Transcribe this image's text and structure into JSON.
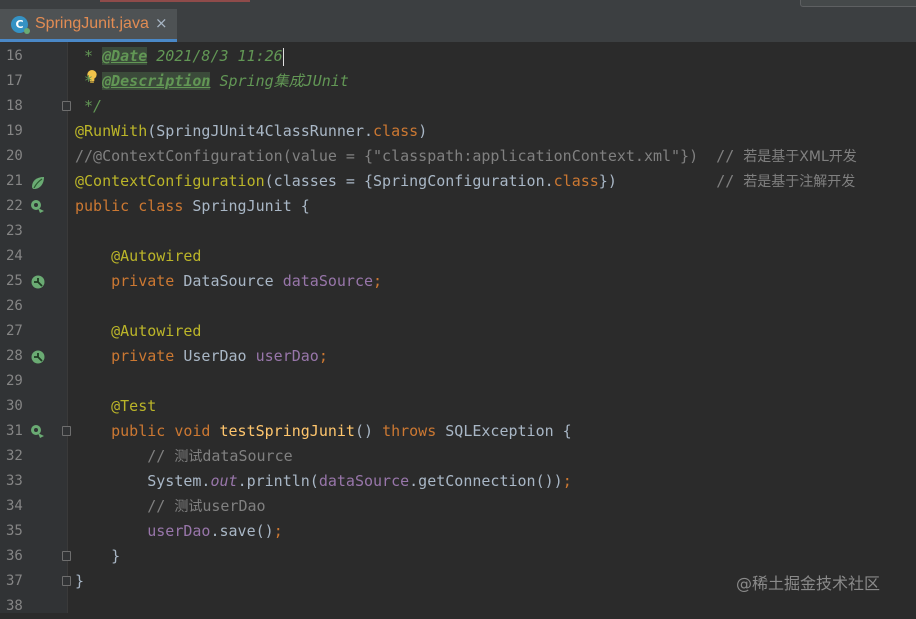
{
  "tab": {
    "label": "SpringJunit.java",
    "close": "×",
    "icon_letter": "C"
  },
  "lines": [
    {
      "n": "16"
    },
    {
      "n": "17"
    },
    {
      "n": "18"
    },
    {
      "n": "19"
    },
    {
      "n": "20"
    },
    {
      "n": "21"
    },
    {
      "n": "22"
    },
    {
      "n": "23"
    },
    {
      "n": "24"
    },
    {
      "n": "25"
    },
    {
      "n": "26"
    },
    {
      "n": "27"
    },
    {
      "n": "28"
    },
    {
      "n": "29"
    },
    {
      "n": "30"
    },
    {
      "n": "31"
    },
    {
      "n": "32"
    },
    {
      "n": "33"
    },
    {
      "n": "34"
    },
    {
      "n": "35"
    },
    {
      "n": "36"
    },
    {
      "n": "37"
    },
    {
      "n": "38"
    }
  ],
  "code": {
    "l16": {
      "star": " * ",
      "tag": "@Date",
      "text": " 2021/8/3 11:26"
    },
    "l17": {
      "star": " * ",
      "tag": "@Description",
      "text": " Spring集成JUnit"
    },
    "l18": {
      "text": " */"
    },
    "l19": {
      "ann": "@RunWith",
      "p1": "(SpringJUnit4ClassRunner.",
      "kw": "class",
      "p2": ")"
    },
    "l20": {
      "text": "//@ContextConfiguration(value = {\"classpath:applicationContext.xml\"})  // ",
      "zh": "若是基于XML开发"
    },
    "l21": {
      "ann": "@ContextConfiguration",
      "p1": "(classes = {SpringConfiguration.",
      "kw": "class",
      "p2": "})",
      "pad": "           ",
      "cm": "// ",
      "zh": "若是基于注解开发"
    },
    "l22": {
      "kw1": "public",
      "kw2": "class",
      "name": " SpringJunit {"
    },
    "l24": {
      "ann": "@Autowired"
    },
    "l25": {
      "kw": "private",
      "type": " DataSource ",
      "field": "dataSource",
      "end": ";"
    },
    "l27": {
      "ann": "@Autowired"
    },
    "l28": {
      "kw": "private",
      "type": " UserDao ",
      "field": "userDao",
      "end": ";"
    },
    "l30": {
      "ann": "@Test"
    },
    "l31": {
      "kw1": "public",
      "kw2": "void",
      "method": "testSpringJunit",
      "p1": "() ",
      "kw3": "throws",
      "p2": " SQLException {"
    },
    "l32": {
      "cm": "// ",
      "zh": "测试",
      "rest": "dataSource"
    },
    "l33": {
      "sys": "System.",
      "static": "out",
      "p1": ".println(",
      "field": "dataSource",
      "p2": ".getConnection())",
      "end": ";"
    },
    "l34": {
      "cm": "// ",
      "zh": "测试",
      "rest": "userDao"
    },
    "l35": {
      "field": "userDao",
      "p1": ".save()",
      "end": ";"
    },
    "l36": {
      "text": "}"
    },
    "l37": {
      "text": "}"
    }
  },
  "watermark": "@稀土掘金技术社区",
  "colors": {
    "keyword": "#cc7832",
    "annotation": "#bbb529",
    "comment": "#808080",
    "javadoc": "#629755",
    "field": "#9876aa",
    "method": "#ffc66d",
    "tab_label": "#e28c53",
    "background": "#2b2b2b"
  }
}
